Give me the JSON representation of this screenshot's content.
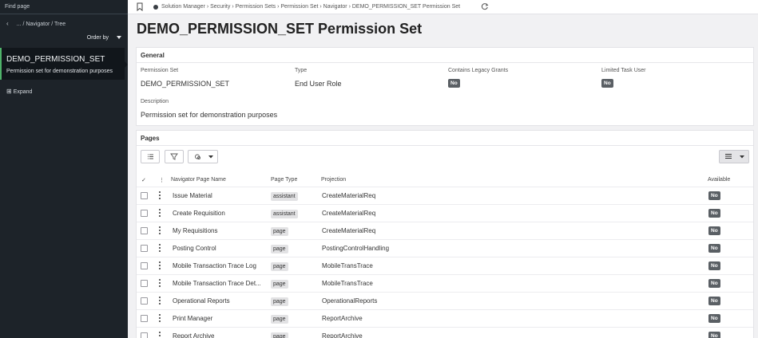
{
  "sidebar": {
    "find_page": "Find page",
    "breadcrumb": "... / Navigator / Tree",
    "order_by": "Order by",
    "selected_title": "DEMO_PERMISSION_SET",
    "selected_desc": "Permission set for demonstration purposes",
    "expand": "Expand"
  },
  "topbar": {
    "breadcrumbs": "Solution Manager › Security › Permission Sets › Permission Set › Navigator › DEMO_PERMISSION_SET Permission Set"
  },
  "page_title": "DEMO_PERMISSION_SET Permission Set",
  "general": {
    "heading": "General",
    "permission_set_label": "Permission Set",
    "permission_set_value": "DEMO_PERMISSION_SET",
    "type_label": "Type",
    "type_value": "End User Role",
    "legacy_label": "Contains Legacy Grants",
    "legacy_value": "No",
    "limited_label": "Limited Task User",
    "limited_value": "No",
    "description_label": "Description",
    "description_value": "Permission set for demonstration purposes"
  },
  "pages": {
    "heading": "Pages",
    "columns": {
      "check": "✓",
      "name": "Navigator Page Name",
      "type": "Page Type",
      "projection": "Projection",
      "available": "Available"
    },
    "rows": [
      {
        "name": "Issue Material",
        "type": "assistant",
        "projection": "CreateMaterialReq",
        "available": "No"
      },
      {
        "name": "Create Requisition",
        "type": "assistant",
        "projection": "CreateMaterialReq",
        "available": "No"
      },
      {
        "name": "My Requisitions",
        "type": "page",
        "projection": "CreateMaterialReq",
        "available": "No"
      },
      {
        "name": "Posting Control",
        "type": "page",
        "projection": "PostingControlHandling",
        "available": "No"
      },
      {
        "name": "Mobile Transaction Trace Log",
        "type": "page",
        "projection": "MobileTransTrace",
        "available": "No"
      },
      {
        "name": "Mobile Transaction Trace Det...",
        "type": "page",
        "projection": "MobileTransTrace",
        "available": "No"
      },
      {
        "name": "Operational Reports",
        "type": "page",
        "projection": "OperationalReports",
        "available": "No"
      },
      {
        "name": "Print Manager",
        "type": "page",
        "projection": "ReportArchive",
        "available": "No"
      },
      {
        "name": "Report Archive",
        "type": "page",
        "projection": "ReportArchive",
        "available": "No"
      }
    ]
  },
  "colors": {
    "sidebar_bg": "#1d2329",
    "selected_accent": "#4fb36a",
    "badge_bg": "#5a5f64"
  }
}
